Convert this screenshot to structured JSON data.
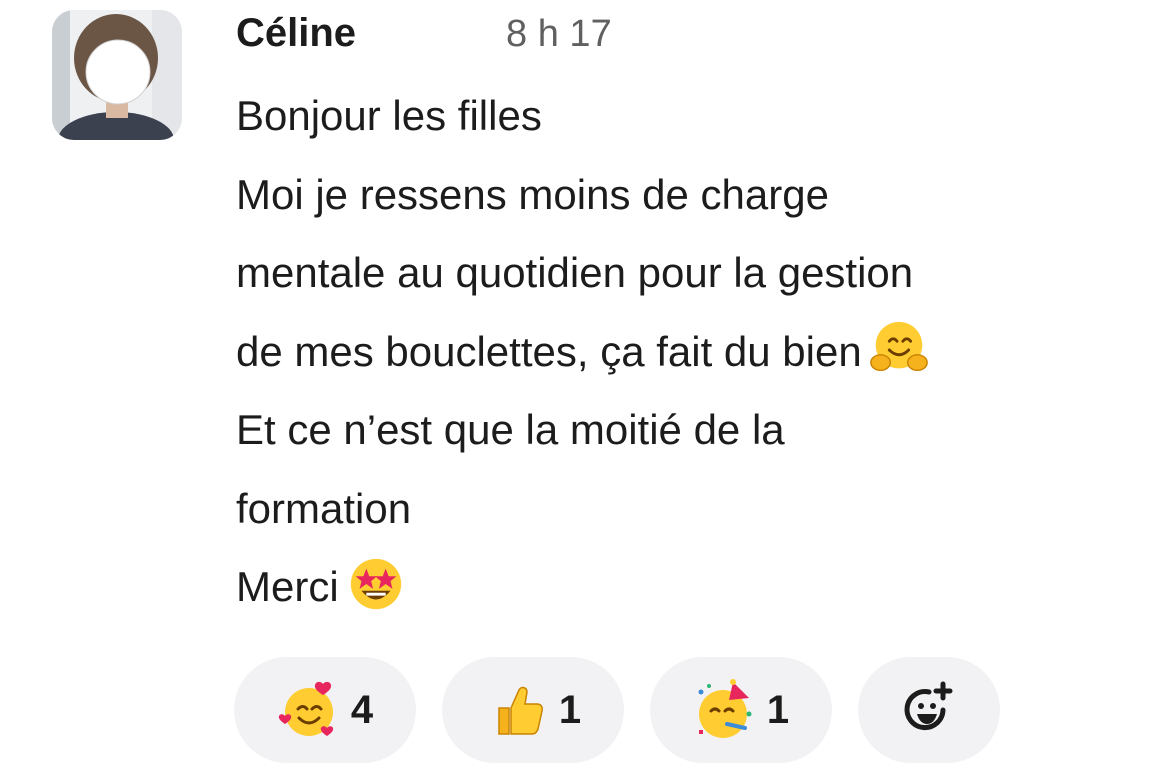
{
  "message": {
    "author": "Céline",
    "timestamp": "8 h 17",
    "lines": [
      "Bonjour les filles",
      "Moi je ressens moins de charge",
      "mentale au quotidien pour la gestion",
      "de mes bouclettes, ça fait du bien",
      "Et ce n’est que la moitié de la",
      "formation",
      "Merci"
    ],
    "inline_emojis": [
      "hugging-face",
      "star-struck"
    ]
  },
  "reactions": [
    {
      "emoji": "smiling-face-with-hearts",
      "count": "4"
    },
    {
      "emoji": "thumbs-up",
      "count": "1"
    },
    {
      "emoji": "partying-face",
      "count": "1"
    },
    {
      "emoji": "add-reaction"
    }
  ]
}
